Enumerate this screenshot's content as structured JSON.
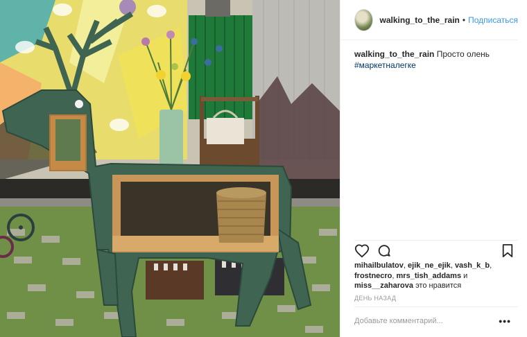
{
  "post": {
    "username": "walking_to_the_rain",
    "separator": "•",
    "follow_label": "Подписаться",
    "caption_text": "Просто олень",
    "hashtag": "#маркетналегке",
    "likes": {
      "names": [
        "mihailbulatov",
        "ejik_ne_ejik",
        "vash_k_b",
        "frostnecro",
        "mrs_tish_addams"
      ],
      "and_word": "и",
      "last_name": "miss__zaharova",
      "suffix": "это нравится"
    },
    "timestamp": "ДЕНЬ НАЗАД",
    "comment_placeholder": "Добавьте комментарий...",
    "more_label": "•••"
  },
  "icons": {
    "like": "heart-icon",
    "comment": "comment-icon",
    "save": "bookmark-icon",
    "avatar": "avatar"
  },
  "colors": {
    "link": "#3897f0",
    "hashtag": "#003569",
    "text": "#262626",
    "muted": "#999999"
  }
}
